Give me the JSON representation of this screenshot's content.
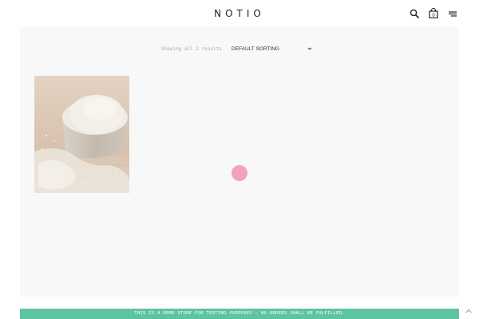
{
  "header": {
    "logo": "NOTIO",
    "icons": [
      "search-icon",
      "cart-icon",
      "menu-icon"
    ],
    "cart_count": "0"
  },
  "shop": {
    "results_text": "Showing all 2 results",
    "sorting": {
      "selected": "DEFAULT SORTING",
      "chevron": "chevron-down-icon"
    },
    "products": [
      {
        "image": "flour-measuring-cup"
      }
    ]
  },
  "loader": {
    "color": "#f2a3bc"
  },
  "footer": {
    "store_notice": "THIS IS A DEMO STORE FOR TESTING PURPOSES — NO ORDERS SHALL BE FULFILLED.",
    "background": "#5cc4a0",
    "scroll_top_icon": "chevron-up-icon"
  }
}
